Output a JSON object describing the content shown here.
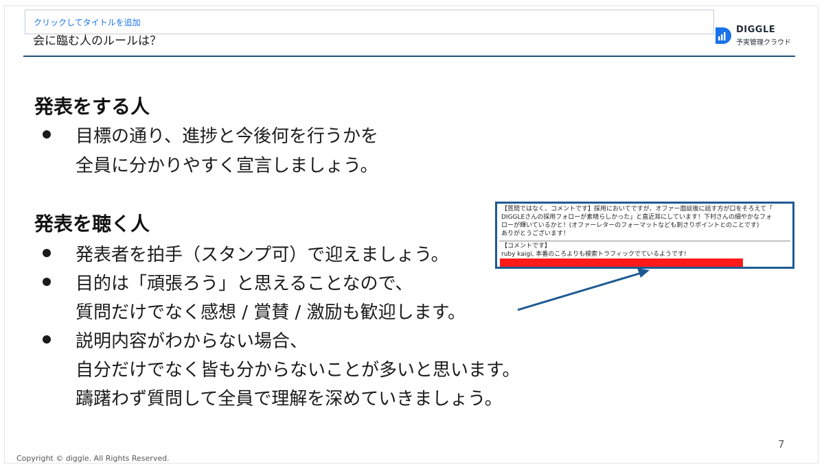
{
  "slide": {
    "title_hint": "クリックしてタイトルを追加",
    "subtitle": "会に臨む人のルールは？",
    "page_number": "7",
    "copyright": "Copyright © diggle. All Rights Reserved."
  },
  "logo": {
    "name": "DIGGLE",
    "tagline": "予実管理クラウド",
    "brand_color": "#1a73e8",
    "icon": "diggle-logo-icon"
  },
  "presenter": {
    "heading": "発表をする人",
    "bullets": [
      {
        "lines": [
          "目標の通り、進捗と今後何を行うかを",
          "全員に分かりやすく宣言しましょう。"
        ]
      }
    ]
  },
  "listener": {
    "heading": "発表を聴く人",
    "bullets": [
      {
        "lines": [
          "発表者を拍手（スタンプ可）で迎えましょう。"
        ]
      },
      {
        "lines": [
          "目的は「頑張ろう」と思えることなので、",
          "質問だけでなく感想 / 賞賛 / 激励も歓迎します。"
        ]
      },
      {
        "lines": [
          "説明内容がわからない場合、",
          "自分だけでなく皆も分からないことが多いと思います。",
          "躊躇わず質問して全員で理解を深めていきましょう。"
        ]
      }
    ]
  },
  "comment_example": {
    "border_color": "#1d5a93",
    "highlight_color": "#ff1a1a",
    "first_comment_lines": [
      "【質問ではなく、コメントです】採用においてですが、オファー面談後に話す方が口をそろえて「",
      "DIGGLEさんの採用フォローが素晴らしかった」と直近耳にしています！下村さんの細やかなフォ",
      "ローが輝いているかと！(オファーレターのフォーマットなども刺さりポイントとのことです)",
      "ありがとうございます！"
    ],
    "second_comment_lines": [
      "【コメントです】",
      "ruby kaigi, 本番のころよりも検索トラフィックでているようです!"
    ]
  },
  "colors": {
    "header_rule": "#1d4f7a",
    "arrow": "#1d5a93"
  }
}
